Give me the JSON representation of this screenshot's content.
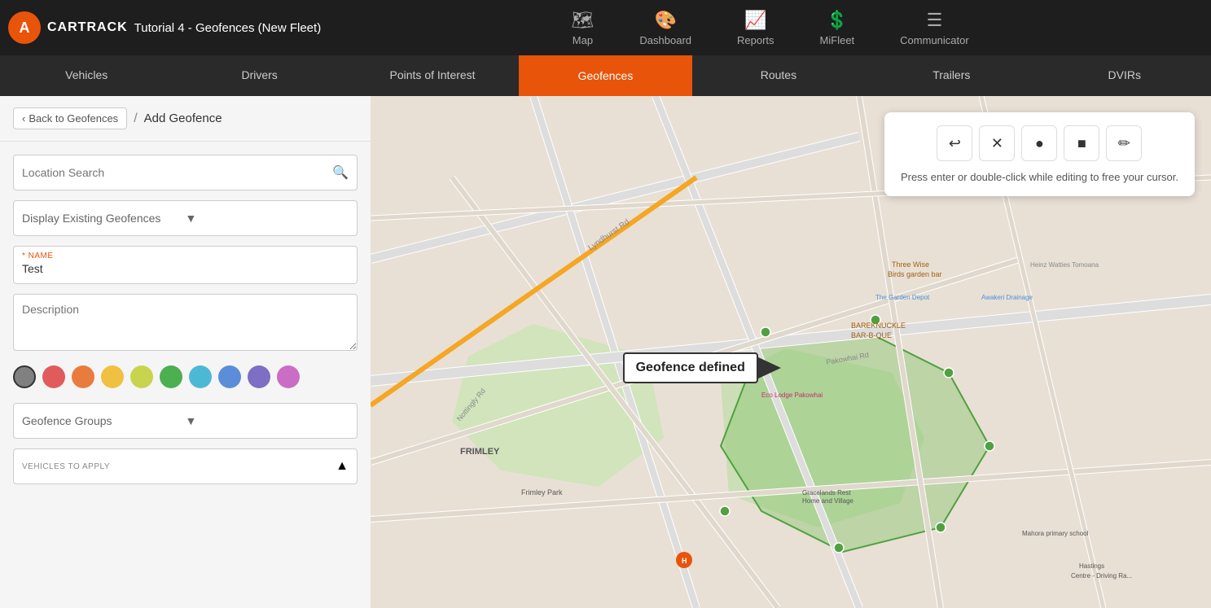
{
  "app": {
    "logo_letter": "A",
    "logo_name": "CARTRACK",
    "page_title": "Tutorial 4 - Geofences (New Fleet)"
  },
  "top_nav": {
    "items": [
      {
        "id": "map",
        "icon": "🗺",
        "label": "Map",
        "active": false
      },
      {
        "id": "dashboard",
        "icon": "🎨",
        "label": "Dashboard",
        "active": false
      },
      {
        "id": "reports",
        "icon": "📈",
        "label": "Reports",
        "active": false
      },
      {
        "id": "mifleet",
        "icon": "💲",
        "label": "MiFleet",
        "active": false
      },
      {
        "id": "communicator",
        "icon": "≔",
        "label": "Communicator",
        "active": false
      }
    ]
  },
  "second_nav": {
    "items": [
      {
        "id": "vehicles",
        "label": "Vehicles",
        "active": false
      },
      {
        "id": "drivers",
        "label": "Drivers",
        "active": false
      },
      {
        "id": "poi",
        "label": "Points of Interest",
        "active": false
      },
      {
        "id": "geofences",
        "label": "Geofences",
        "active": true
      },
      {
        "id": "routes",
        "label": "Routes",
        "active": false
      },
      {
        "id": "trailers",
        "label": "Trailers",
        "active": false
      },
      {
        "id": "dvirs",
        "label": "DVIRs",
        "active": false
      }
    ]
  },
  "breadcrumb": {
    "back_label": "Back to Geofences",
    "separator": "/",
    "current": "Add Geofence"
  },
  "form": {
    "search_placeholder": "Location Search",
    "display_existing_label": "Display Existing Geofences",
    "name_label": "* NAME",
    "name_value": "Test",
    "description_placeholder": "Description",
    "geofence_groups_label": "Geofence Groups",
    "vehicles_label": "VEHICLES TO APPLY"
  },
  "colors": [
    {
      "hex": "#808080",
      "selected": true
    },
    {
      "hex": "#e05c5c"
    },
    {
      "hex": "#e87c3e"
    },
    {
      "hex": "#f0c040"
    },
    {
      "hex": "#c8d44e"
    },
    {
      "hex": "#4caf50"
    },
    {
      "hex": "#4db8d4"
    },
    {
      "hex": "#5b8dd9"
    },
    {
      "hex": "#7e6ec4"
    },
    {
      "hex": "#c96ec4"
    }
  ],
  "map_toolbar": {
    "undo_icon": "↩",
    "close_icon": "✕",
    "circle_icon": "●",
    "square_icon": "■",
    "edit_icon": "✏",
    "hint": "Press enter or double-click while editing to free your cursor."
  },
  "map": {
    "geofence_label": "Geofence defined"
  }
}
